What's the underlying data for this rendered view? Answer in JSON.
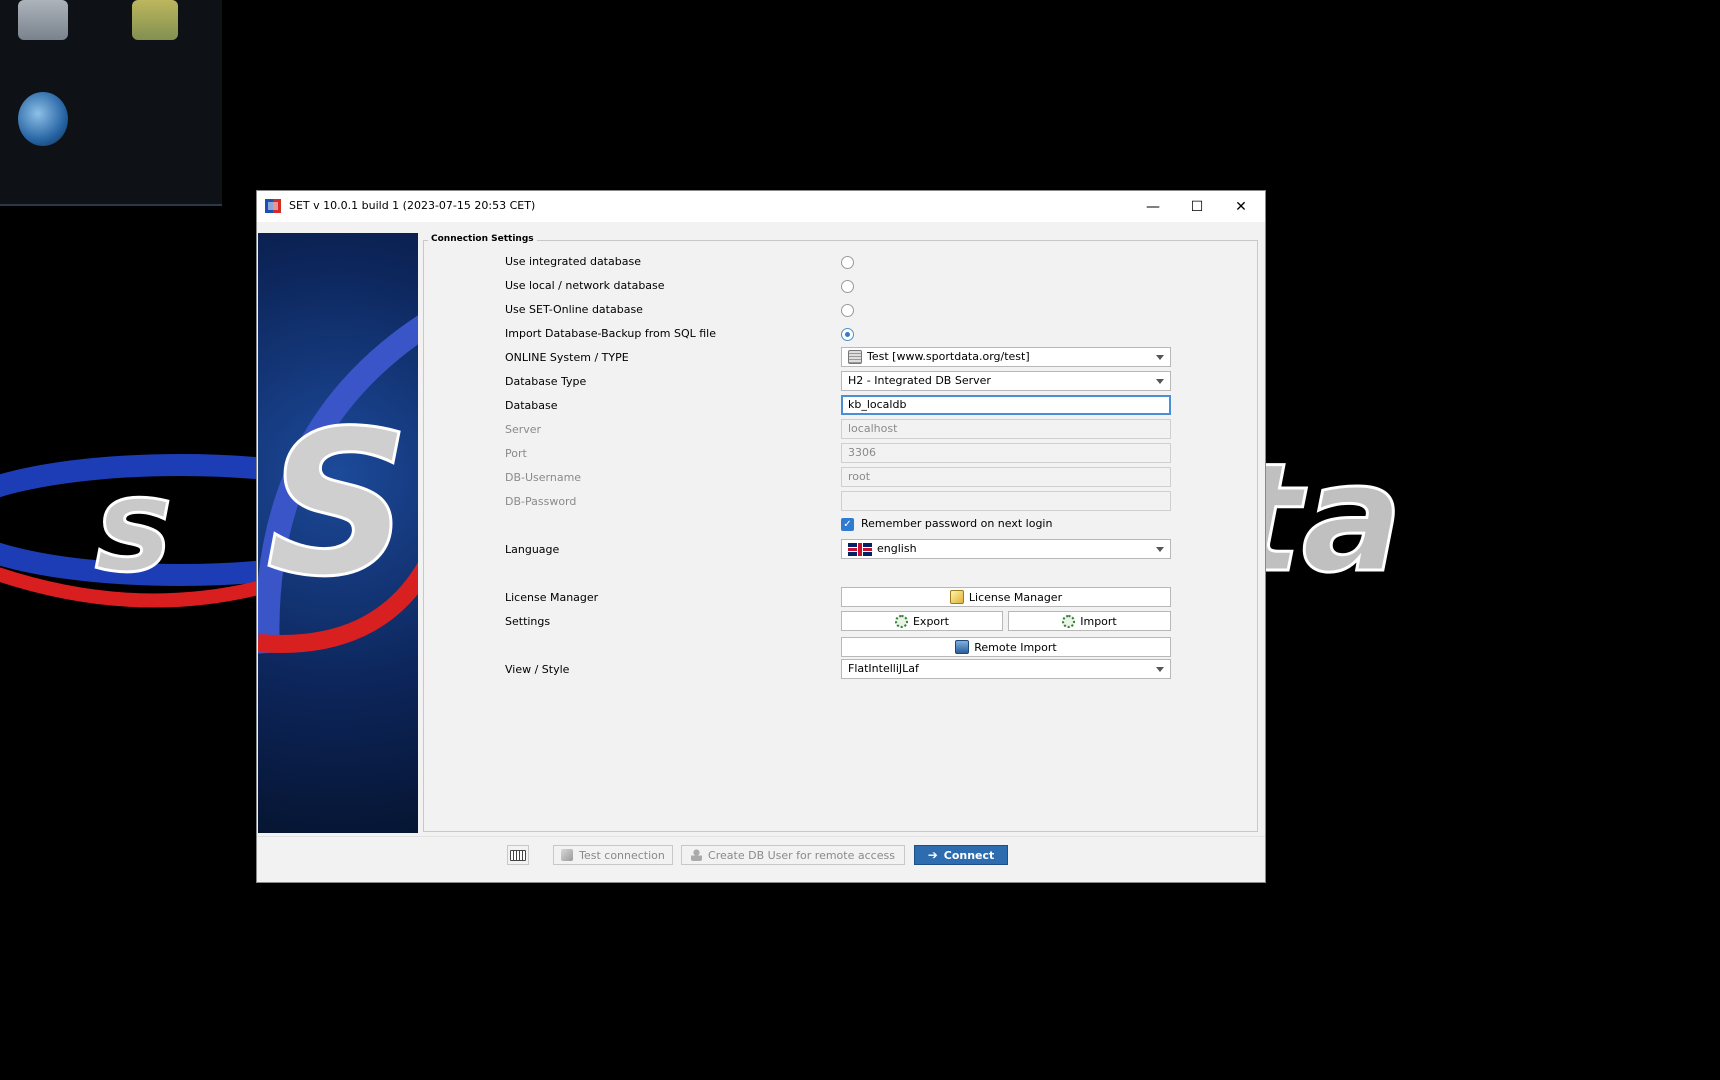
{
  "window": {
    "title": "SET v 10.0.1 build 1 (2023-07-15 20:53 CET)",
    "controls": {
      "minimize": "—",
      "maximize": "☐",
      "close": "✕"
    }
  },
  "panel": {
    "legend": "Connection Settings"
  },
  "options": {
    "integrated": "Use integrated database",
    "local_network": "Use local / network database",
    "online": "Use SET-Online database",
    "import_sql": "Import Database-Backup from SQL file",
    "selected": "import_sql"
  },
  "fields": {
    "online_system_label": "ONLINE System / TYPE",
    "online_system_value": "Test [www.sportdata.org/test]",
    "db_type_label": "Database Type",
    "db_type_value": "H2 - Integrated DB Server",
    "database_label": "Database",
    "database_value": "kb_localdb",
    "server_label": "Server",
    "server_value": "localhost",
    "port_label": "Port",
    "port_value": "3306",
    "db_username_label": "DB-Username",
    "db_username_value": "root",
    "db_password_label": "DB-Password",
    "db_password_value": "",
    "remember_password": "Remember password on next login",
    "remember_checked": true,
    "language_label": "Language",
    "language_value": "english",
    "license_label": "License Manager",
    "license_button": "License Manager",
    "settings_label": "Settings",
    "export_button": "Export",
    "import_button": "Import",
    "remote_import_button": "Remote Import",
    "view_style_label": "View / Style",
    "view_style_value": "FlatIntelliJLaf"
  },
  "footer": {
    "test_connection": "Test connection",
    "create_db_user": "Create DB User for remote access",
    "connect": "Connect"
  },
  "colors": {
    "accent": "#2e6cb0",
    "focus": "#4a8fd6"
  }
}
